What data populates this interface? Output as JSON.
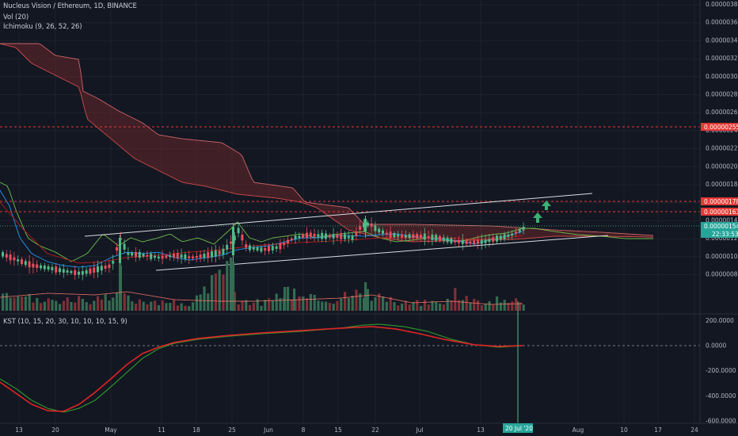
{
  "symbol": {
    "title": "Nucleus Vision / Ethereum, 1D, BINANCE",
    "volume_indicator": "Vol (20)",
    "ichimoku_indicator": "Ichimoku (9, 26, 52, 26)",
    "kst_indicator": "KST (10, 15, 20, 30, 10, 10, 10, 15, 9)"
  },
  "price_axis": {
    "labels": [
      "0.00000380",
      "0.00000360",
      "0.00000340",
      "0.00000320",
      "0.00000300",
      "0.00000280",
      "0.00000260",
      "0.00000240",
      "0.00000220",
      "0.00000200",
      "0.00000180",
      "0.00000160",
      "0.00000140",
      "0.00000120",
      "0.00000100",
      "0.00000080"
    ]
  },
  "price_tags": {
    "resistance_top": "0.00000255",
    "resistance_mid": "0.00000178",
    "resistance_low": "0.00000163",
    "last_price": "0.00000154",
    "countdown": "22:33:53"
  },
  "kst_axis": {
    "labels": [
      "200.0000",
      "0.0000",
      "-200.0000",
      "-400.0000",
      "-600.0000"
    ]
  },
  "time_axis": {
    "labels": [
      "13",
      "20",
      "May",
      "11",
      "18",
      "25",
      "Jun",
      "8",
      "15",
      "22",
      "Jul",
      "13",
      "Aug",
      "10",
      "17",
      "24"
    ],
    "cursor_label": "20 Jul '20"
  },
  "colors": {
    "background": "#131722",
    "up": "#53b987",
    "down": "#eb4d5c",
    "cloud": "#8c2f30",
    "resistance_line": "#e53935",
    "kst": "#2e8b2e",
    "kst_signal": "#e02424",
    "accent_arrow": "#3bb273"
  },
  "icons": {
    "breakout_arrow": "arrow-up-icon"
  }
}
